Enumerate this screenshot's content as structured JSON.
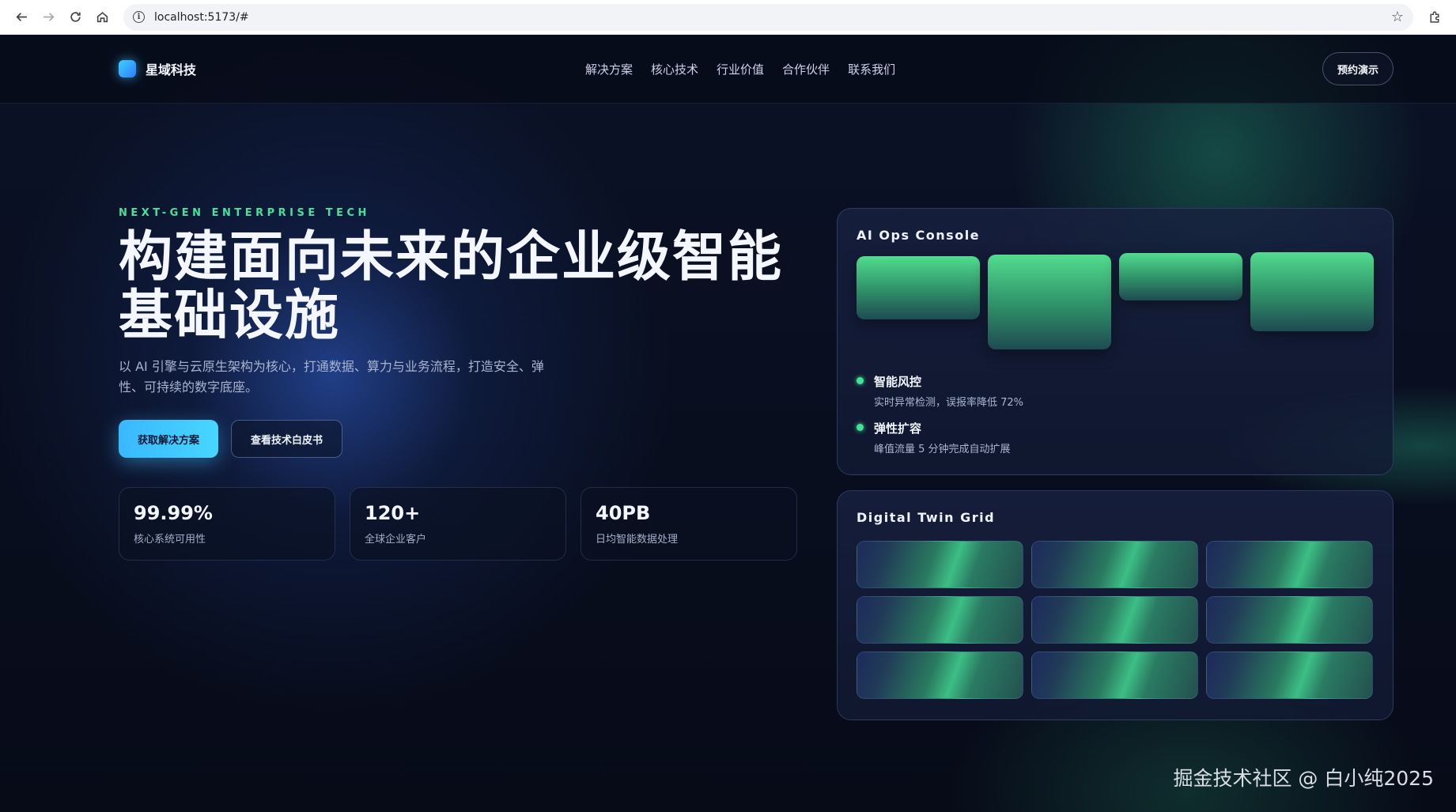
{
  "browser": {
    "url": "localhost:5173/#"
  },
  "nav": {
    "brand": "星域科技",
    "links": [
      "解决方案",
      "核心技术",
      "行业价值",
      "合作伙伴",
      "联系我们"
    ],
    "cta": "预约演示"
  },
  "hero": {
    "eyebrow": "NEXT-GEN ENTERPRISE TECH",
    "title_line1": "构建面向未来的企业级智能",
    "title_line2": "基础设施",
    "subtitle": "以 AI 引擎与云原生架构为核心，打通数据、算力与业务流程，打造安全、弹性、可持续的数字底座。",
    "primary_button": "获取解决方案",
    "secondary_button": "查看技术白皮书"
  },
  "stats": [
    {
      "value": "99.99%",
      "label": "核心系统可用性"
    },
    {
      "value": "120+",
      "label": "全球企业客户"
    },
    {
      "value": "40PB",
      "label": "日均智能数据处理"
    }
  ],
  "ops_console": {
    "title": "AI Ops Console",
    "features": [
      {
        "title": "智能风控",
        "desc": "实时异常检测，误报率降低 72%"
      },
      {
        "title": "弹性扩容",
        "desc": "峰值流量 5 分钟完成自动扩展"
      }
    ]
  },
  "digital_twin": {
    "title": "Digital Twin Grid"
  },
  "watermark": "掘金技术社区 @ 白小纯2025",
  "colors": {
    "accent_green": "#41e394",
    "accent_blue": "#3ab8ff",
    "background": "#070b18"
  }
}
